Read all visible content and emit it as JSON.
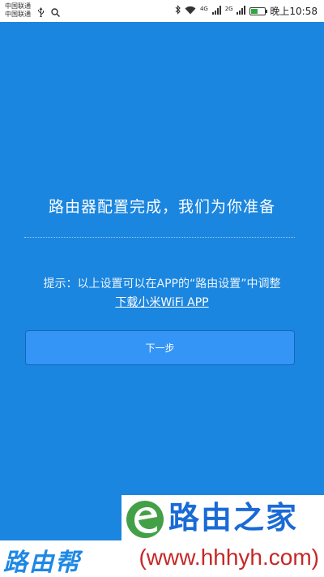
{
  "status_bar": {
    "carrier_1": "中国联通",
    "carrier_2": "中国联通",
    "net_4g": "4G",
    "net_2g": "2G",
    "time": "晚上10:58",
    "battery_level": 0.5,
    "battery_color": "#2eaa3c"
  },
  "main": {
    "title": "路由器配置完成，我们为你准备",
    "hint": "提示：以上设置可以在APP的“路由设置”中调整",
    "download_link": "下载小米WiFi APP",
    "next_button": "下一步"
  },
  "watermark": {
    "brand_name": "路由之家",
    "brand_left": "路由帮",
    "url": "(www.hhhyh.com)"
  },
  "colors": {
    "background": "#1b86df",
    "button": "#3595f7",
    "brand_blue": "#1a6ad6",
    "brand_green": "#43a047",
    "url_red": "#c62828"
  }
}
